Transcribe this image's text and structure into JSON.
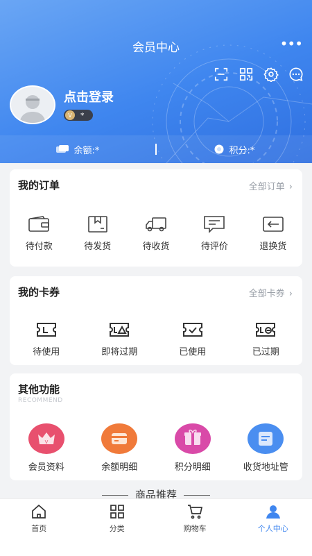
{
  "header": {
    "title": "会员中心",
    "more": "•••"
  },
  "user": {
    "login_text": "点击登录",
    "vip_level": "*",
    "vip_mark": "V"
  },
  "balance": {
    "label": "余额:*",
    "points": "积分:*"
  },
  "orders": {
    "title": "我的订单",
    "all_link": "全部订单",
    "items": [
      {
        "label": "待付款",
        "icon": "wallet-icon"
      },
      {
        "label": "待发货",
        "icon": "box-icon"
      },
      {
        "label": "待收货",
        "icon": "truck-icon"
      },
      {
        "label": "待评价",
        "icon": "comment-icon"
      },
      {
        "label": "退换货",
        "icon": "return-icon"
      }
    ]
  },
  "coupons": {
    "title": "我的卡券",
    "all_link": "全部卡券",
    "items": [
      {
        "label": "待使用",
        "icon": "ticket-icon"
      },
      {
        "label": "即将过期",
        "icon": "ticket-warning-icon"
      },
      {
        "label": "已使用",
        "icon": "ticket-check-icon"
      },
      {
        "label": "已过期",
        "icon": "ticket-expired-icon"
      }
    ]
  },
  "functions": {
    "title": "其他功能",
    "subtitle": "RECOMMEND",
    "items": [
      {
        "label": "会员资料",
        "icon": "member-crown-icon",
        "color": "#e24a6a"
      },
      {
        "label": "余额明细",
        "icon": "card-icon",
        "color": "#f07a3a"
      },
      {
        "label": "积分明细",
        "icon": "gift-icon",
        "color": "#d94aa8"
      },
      {
        "label": "收货地址管",
        "icon": "address-icon",
        "color": "#4a8ef0"
      }
    ]
  },
  "recommend": {
    "title": "商品推荐"
  },
  "tabbar": {
    "items": [
      {
        "label": "首页",
        "icon": "home-icon",
        "active": false
      },
      {
        "label": "分类",
        "icon": "grid-icon",
        "active": false
      },
      {
        "label": "购物车",
        "icon": "cart-icon",
        "active": false
      },
      {
        "label": "个人中心",
        "icon": "user-icon",
        "active": true
      }
    ]
  },
  "colors": {
    "accent": "#3f86ef",
    "hero": "#4a8df0"
  }
}
